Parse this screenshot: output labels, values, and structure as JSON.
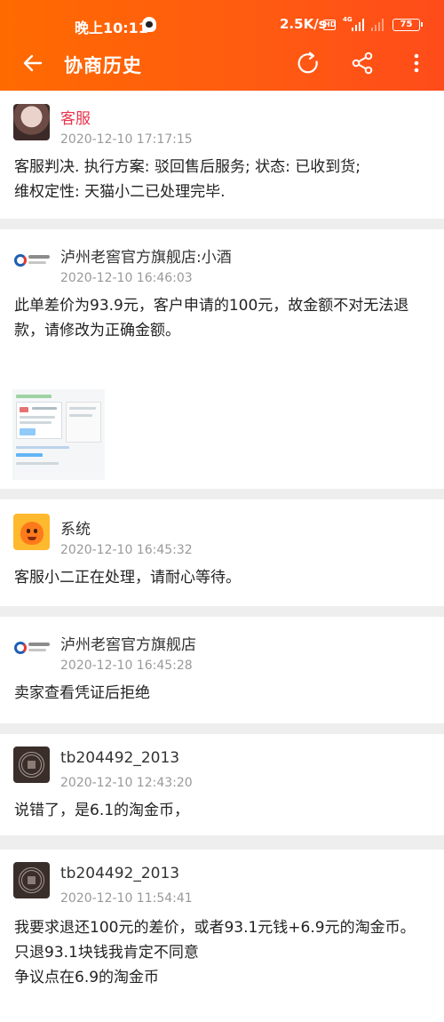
{
  "status_bar": {
    "time": "晚上10:11",
    "net_speed": "2.5K/s",
    "hd_badge": "HD",
    "network_type": "4G",
    "battery": "75"
  },
  "header": {
    "title": "协商历史",
    "back_icon": "arrow-left-icon",
    "refresh_icon": "refresh-icon",
    "share_icon": "share-icon",
    "more_icon": "more-vertical-icon",
    "background": "#ff5a12"
  },
  "records": [
    {
      "author": "客服",
      "author_color": "#e8334b",
      "time": "2020-12-10 17:17:15",
      "avatar": "agent-photo-avatar",
      "message": "客服判决. 执行方案: 驳回售后服务; 状态: 已收到货;\n维权定性: 天猫小二已处理完毕."
    },
    {
      "author": "泸州老窖官方旗舰店:小酒",
      "time": "2020-12-10 16:46:03",
      "avatar": "luzhou-laojiao-logo",
      "message": "此单差价为93.9元，客户申请的100元，故金额不对无法退款，请修改为正确金额。",
      "attachment": "screenshot-thumbnail"
    },
    {
      "author": "系统",
      "time": "2020-12-10 16:45:32",
      "avatar": "system-mascot-avatar",
      "message": "客服小二正在处理，请耐心等待。"
    },
    {
      "author": "泸州老窖官方旗舰店",
      "time": "2020-12-10 16:45:28",
      "avatar": "luzhou-laojiao-logo",
      "message": "卖家查看凭证后拒绝"
    },
    {
      "author": "tb204492_2013",
      "time": "2020-12-10 12:43:20",
      "avatar": "qr-code-avatar",
      "message": "说错了，是6.1的淘金币，"
    },
    {
      "author": "tb204492_2013",
      "time": "2020-12-10 11:54:41",
      "avatar": "qr-code-avatar",
      "message": "我要求退还100元的差价，或者93.1元钱+6.9元的淘金币。\n只退93.1块钱我肯定不同意\n争议点在6.9的淘金币"
    }
  ]
}
